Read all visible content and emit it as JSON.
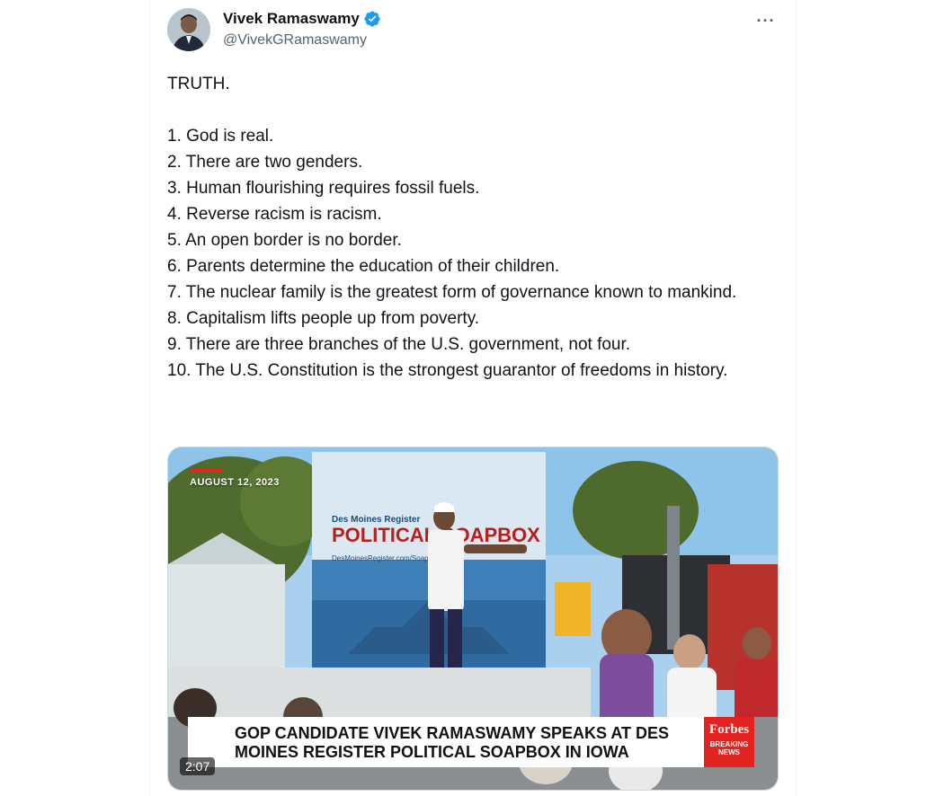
{
  "author": {
    "display_name": "Vivek Ramaswamy",
    "handle": "@VivekGRamaswamy",
    "verified": true,
    "avatar_icon": "user-avatar"
  },
  "more_menu": {
    "icon": "more-horizontal-icon",
    "label": "···"
  },
  "tweet": {
    "text": "TRUTH.\n\n1. God is real.\n2. There are two genders.\n3. Human flourishing requires fossil fuels.\n4. Reverse racism is racism.\n5. An open border is no border.\n6. Parents determine the education of their children.\n7. The nuclear family is the greatest form of governance known to mankind.\n8. Capitalism lifts people up from poverty.\n9. There are three branches of the U.S. government, not four.\n10. The U.S. Constitution is the strongest guarantor of freedoms in history."
  },
  "video": {
    "date_overlay": "AUGUST 12, 2023",
    "headline": "GOP CANDIDATE VIVEK RAMASWAMY SPEAKS AT DES MOINES REGISTER POLITICAL SOAPBOX IN IOWA",
    "brand": "Forbes",
    "brand_sub": "BREAKING NEWS",
    "duration": "2:07",
    "banner_top": "Des Moines Register",
    "banner_main": "POLITICAL SOAPBOX",
    "banner_url": "DesMoinesRegister.com/Soapbox"
  },
  "colors": {
    "verified_blue": "#1d9bf0",
    "forbes_red": "#e3231f",
    "text_primary": "#0f1419",
    "text_secondary": "#536471"
  }
}
